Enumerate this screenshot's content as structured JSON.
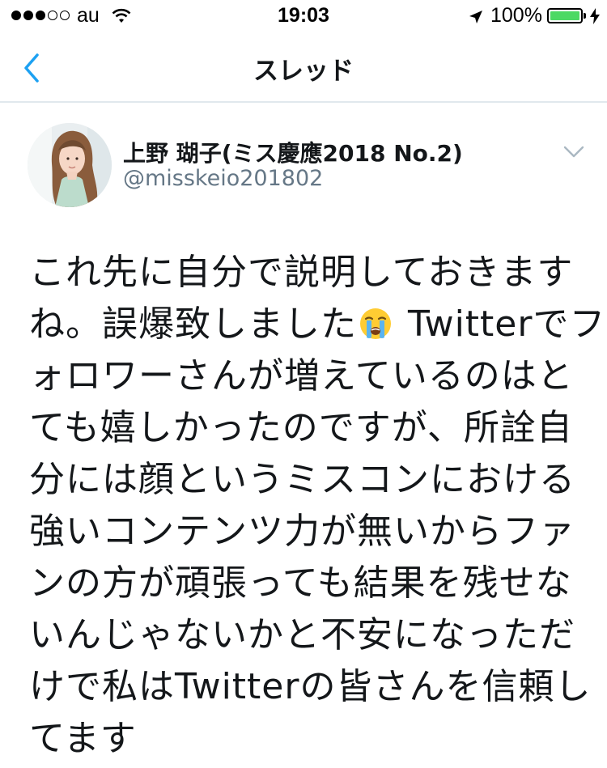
{
  "status_bar": {
    "carrier": "au",
    "time": "19:03",
    "battery_percent": "100%",
    "signal_strength": 3,
    "signal_max": 5,
    "battery_level": 1.0,
    "battery_color": "#4cd964",
    "icons": [
      "wifi-icon",
      "location-arrow-icon",
      "battery-icon",
      "charging-bolt-icon"
    ]
  },
  "nav": {
    "title": "スレッド",
    "back_icon": "chevron-left-icon",
    "accent_color": "#1da1f2"
  },
  "tweet": {
    "author_name": "上野 瑚子(ミス慶應2018 No.2)",
    "author_handle": "@misskeio201802",
    "menu_icon": "chevron-down-icon",
    "emoji": "loudly-crying-face-emoji",
    "lines": [
      "これ先に自分で説明しておきます",
      "ね。誤爆致しました",
      " Twitterでフ",
      "ォロワーさんが増えているのはと",
      "ても嬉しかったのですが、所詮自",
      "分には顔というミスコンにおける",
      "強いコンテンツ力が無いからファ",
      "ンの方が頑張っても結果を残せな",
      "いんじゃないかと不安になっただ",
      "けで私はTwitterの皆さんを信頼し",
      "てます"
    ]
  }
}
